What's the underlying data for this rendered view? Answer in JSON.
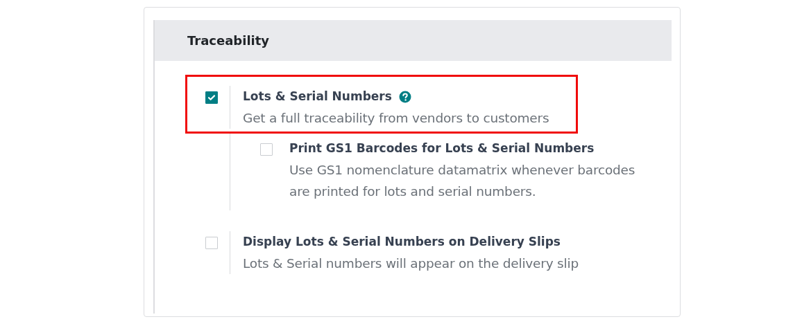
{
  "section": {
    "title": "Traceability"
  },
  "settings": [
    {
      "title": "Lots & Serial Numbers",
      "description": "Get a full traceability from vendors to customers",
      "checked": true,
      "help": true,
      "highlighted": true,
      "children": [
        {
          "title": "Print GS1 Barcodes for Lots & Serial Numbers",
          "description": "Use GS1 nomenclature datamatrix whenever barcodes are printed for lots and serial numbers.",
          "checked": false
        }
      ]
    },
    {
      "title": "Display Lots & Serial Numbers on Delivery Slips",
      "description": "Lots & Serial numbers will appear on the delivery slip",
      "checked": false,
      "help": false,
      "highlighted": false
    }
  ]
}
